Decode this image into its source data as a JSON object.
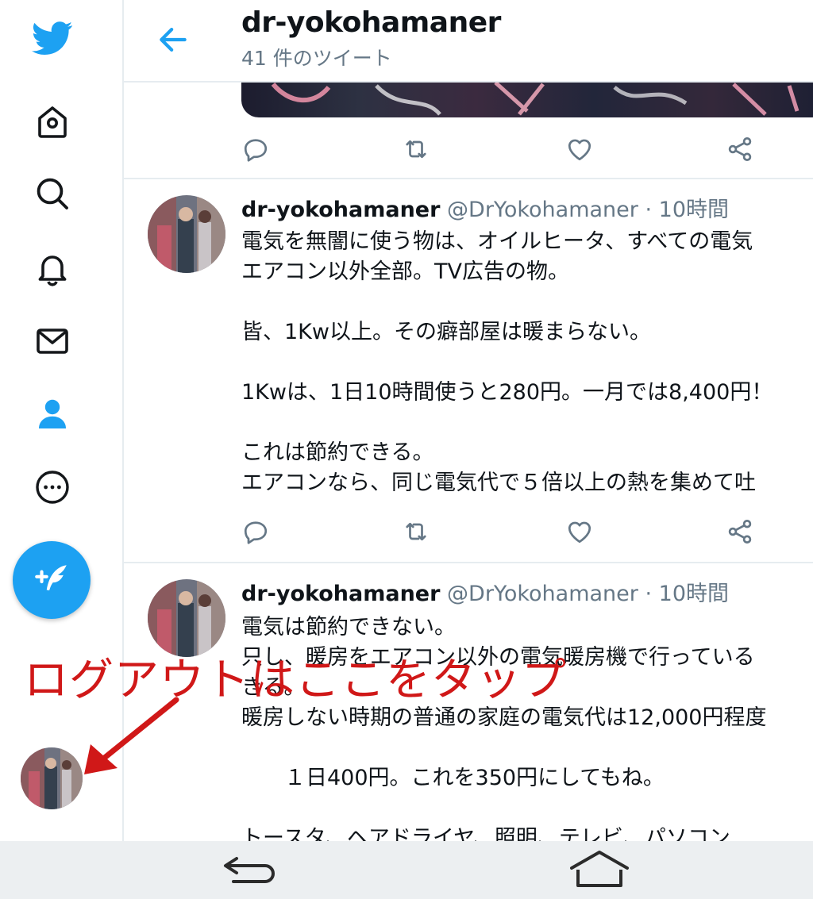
{
  "header": {
    "title": "dr-yokohamaner",
    "subtitle": "41 件のツイート"
  },
  "sidebar": {
    "items": [
      {
        "icon": "twitter-bird-icon"
      },
      {
        "icon": "home-icon"
      },
      {
        "icon": "search-icon"
      },
      {
        "icon": "bell-icon"
      },
      {
        "icon": "mail-icon"
      },
      {
        "icon": "profile-icon",
        "active": true
      },
      {
        "icon": "more-icon"
      }
    ],
    "compose_icon": "compose-tweet-icon"
  },
  "tweets": [
    {
      "name": "dr-yokohamaner",
      "handle": "@DrYokohamaner",
      "dot": "·",
      "time": "10時間",
      "lines": [
        "電気を無闇に使う物は、オイルヒータ、すべての電気",
        "エアコン以外全部。TV広告の物。",
        "",
        "皆、1Kw以上。その癖部屋は暖まらない。",
        "",
        "1Kwは、1日10時間使うと280円。一月では8,400円！",
        "",
        "これは節約できる。",
        "エアコンなら、同じ電気代で５倍以上の熱を集めて吐"
      ]
    },
    {
      "name": "dr-yokohamaner",
      "handle": "@DrYokohamaner",
      "dot": "·",
      "time": "10時間",
      "lines": [
        "電気は節約できない。",
        "只し、暖房をエアコン以外の電気暖房機で行っている",
        "きる。",
        "暖房しない時期の普通の家庭の電気代は12,000円程度",
        "",
        "　　１日400円。これを350円にしてもね。",
        "",
        "トースタ、ヘアドライヤ、照明、テレビ、パソコン"
      ]
    }
  ],
  "annotation": {
    "text": "ログアウトはここをタップ",
    "color": "#d01818"
  },
  "colors": {
    "accent": "#1da1f2",
    "secondary_text": "#657786",
    "divider": "#e6ecf0"
  }
}
